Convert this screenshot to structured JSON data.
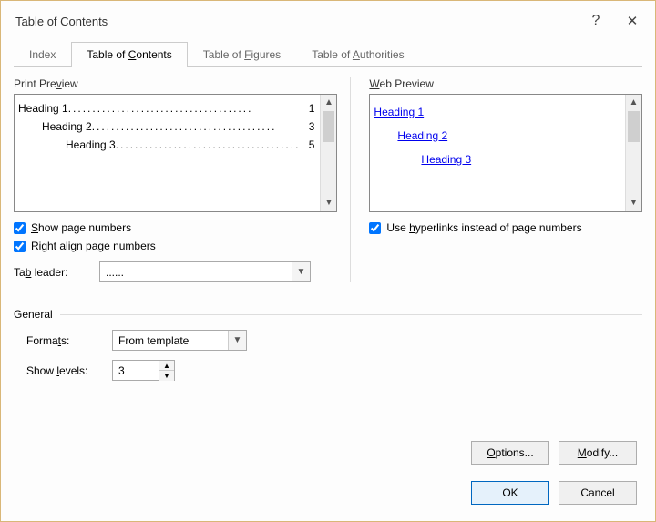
{
  "window": {
    "title": "Table of Contents"
  },
  "tabs": {
    "index": "Index",
    "toc_pre": "Table of ",
    "toc_u": "C",
    "toc_post": "ontents",
    "tof_pre": "Table of ",
    "tof_u": "F",
    "tof_post": "igures",
    "toa_pre": "Table of ",
    "toa_u": "A",
    "toa_post": "uthorities"
  },
  "print": {
    "label_pre": "Print Pre",
    "label_u": "v",
    "label_post": "iew",
    "h1": "Heading 1",
    "p1": "1",
    "h2": "Heading 2",
    "p2": "3",
    "h3": "Heading 3",
    "p3": "5",
    "dots": "......................................"
  },
  "web": {
    "label_u": "W",
    "label_post": "eb Preview",
    "h1": "Heading 1",
    "h2": "Heading 2",
    "h3": "Heading 3"
  },
  "options": {
    "show_pn_u": "S",
    "show_pn_post": "how page numbers",
    "right_align_u": "R",
    "right_align_post": "ight align page numbers",
    "use_hyper_pre": "Use ",
    "use_hyper_u": "h",
    "use_hyper_post": "yperlinks instead of page numbers",
    "tab_leader_pre": "Ta",
    "tab_leader_u": "b",
    "tab_leader_post": " leader:",
    "tab_leader_value": "......"
  },
  "general": {
    "label": "General",
    "formats_pre": "Forma",
    "formats_u": "t",
    "formats_post": "s:",
    "formats_value": "From template",
    "levels_pre": "Show ",
    "levels_u": "l",
    "levels_post": "evels:",
    "levels_value": "3"
  },
  "buttons": {
    "options_u": "O",
    "options_post": "ptions...",
    "modify_u": "M",
    "modify_post": "odify...",
    "ok": "OK",
    "cancel": "Cancel"
  }
}
